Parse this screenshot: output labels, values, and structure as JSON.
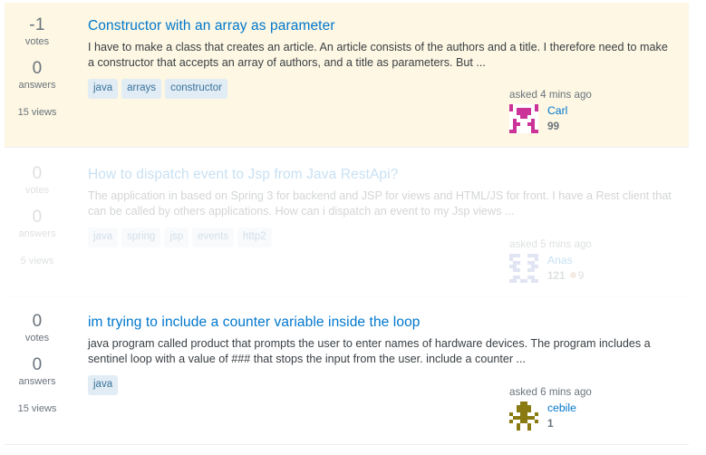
{
  "theme": {
    "highlight_bg": "#fdf7e3",
    "page_bg": "#ffffff",
    "link_blue": "#0077cc",
    "tag_bg": "#e1ecf4",
    "tag_text": "#39739d",
    "muted_text": "#6a737c",
    "divider": "#eceef0",
    "bronze_badge": "#d1a684"
  },
  "labels": {
    "votes": "votes",
    "answers": "answers"
  },
  "questions": [
    {
      "votes": "-1",
      "votes_label": "votes",
      "answers": "0",
      "answers_label": "answers",
      "views": "15 views",
      "title": "Constructor with an array as parameter",
      "excerpt": "I have to make a class that creates an article. An article consists of the authors and a title. I therefore need to make a constructor that accepts an array of authors, and a title as parameters. But ...",
      "tags": [
        "java",
        "arrays",
        "constructor"
      ],
      "asked": "asked 4 mins ago",
      "user": {
        "name": "Carl",
        "reputation": "99",
        "badges": [],
        "avatar_color": "#cc3399",
        "avatar_seed": 7
      },
      "highlighted": true,
      "faded": false
    },
    {
      "votes": "0",
      "votes_label": "votes",
      "answers": "0",
      "answers_label": "answers",
      "views": "5 views",
      "title": "How to dispatch event to Jsp from Java RestApi?",
      "excerpt": "The application in based on Spring 3 for backend and JSP for views and HTML/JS for front. I have a Rest client that can be called by others applications. How can i dispatch an event to my Jsp views ...",
      "tags": [
        "java",
        "spring",
        "jsp",
        "events",
        "http2"
      ],
      "asked": "asked 5 mins ago",
      "user": {
        "name": "Anas",
        "reputation": "121",
        "badges": [
          {
            "type": "bronze",
            "count": "9",
            "color": "#d1a684"
          }
        ],
        "avatar_color": "#7788cc",
        "avatar_seed": 13
      },
      "highlighted": false,
      "faded": true
    },
    {
      "votes": "0",
      "votes_label": "votes",
      "answers": "0",
      "answers_label": "answers",
      "views": "15 views",
      "title": "im trying to include a counter variable inside the loop",
      "excerpt": "java program called product that prompts the user to enter names of hardware devices. The program includes a sentinel loop with a value of ### that stops the input from the user. include a counter ...",
      "tags": [
        "java"
      ],
      "asked": "asked 6 mins ago",
      "user": {
        "name": "cebile",
        "reputation": "1",
        "badges": [],
        "avatar_color": "#8a7a12",
        "avatar_seed": 21
      },
      "highlighted": false,
      "faded": false
    }
  ]
}
